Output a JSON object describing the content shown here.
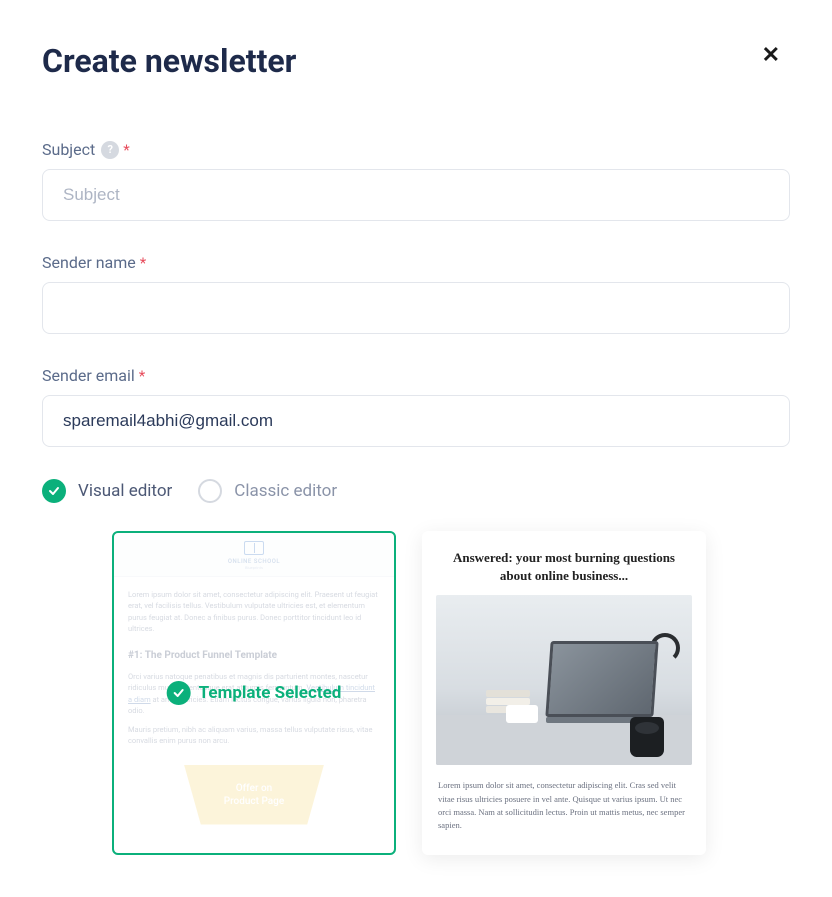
{
  "header": {
    "title": "Create newsletter"
  },
  "fields": {
    "subject": {
      "label": "Subject",
      "placeholder": "Subject",
      "value": ""
    },
    "sender_name": {
      "label": "Sender name",
      "value": ""
    },
    "sender_email": {
      "label": "Sender email",
      "value": "sparemail4abhi@gmail.com"
    }
  },
  "editors": {
    "visual": {
      "label": "Visual editor",
      "active": true
    },
    "classic": {
      "label": "Classic editor",
      "active": false
    }
  },
  "selected_badge": "Template Selected",
  "templates": [
    {
      "selected": true,
      "brand": "ONLINE SCHOOL",
      "brand_sub": "Blueprints",
      "p1": "Lorem ipsum dolor sit amet, consectetur adipiscing elit. Praesent ut feugiat erat, vel facilisis tellus. Vestibulum vulputate ultricies est, et elementum purus feugiat at. Donec a finibus purus. Donec porttitor tincidunt leo id ultrices.",
      "h1": "#1: The Product Funnel Template",
      "p2_a": "Orci varius natoque penatibus et magnis dis parturient montes, nascetur ridiculus mus. Pellentesque erat at turpis fermentum. ",
      "p2_link": "Vestibulum tincidunt a diam",
      "p2_b": " at amet ultricies. Etiam lectus congue, varius ligula non, pharetra odio.",
      "p3": "Mauris pretium, nibh ac aliquam varius, massa tellus vulputate risus, vitae convallis enim purus non arcu.",
      "funnel_l1": "Offer on",
      "funnel_l2": "Product Page"
    },
    {
      "selected": false,
      "headline": "Answered: your most burning questions about online business...",
      "body": "Lorem ipsum dolor sit amet, consectetur adipiscing elit. Cras sed velit vitae risus ultricies posuere in vel ante. Quisque ut varius ipsum. Ut nec orci massa. Nam at sollicitudin lectus. Proin ut mattis metus, nec semper sapien."
    }
  ]
}
